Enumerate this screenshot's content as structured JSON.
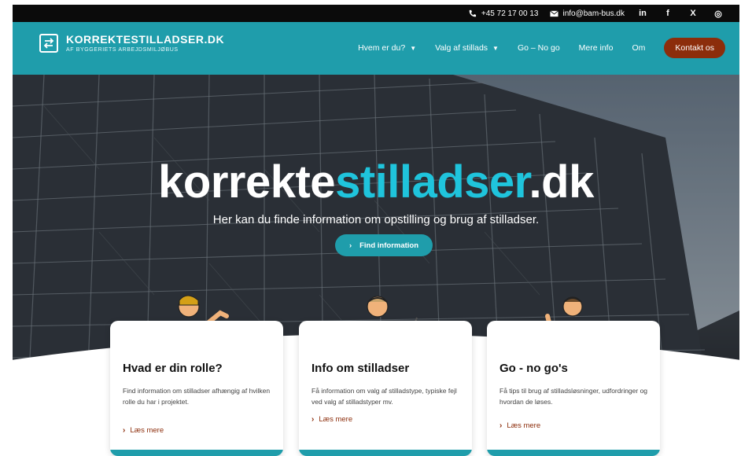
{
  "topbar": {
    "phone": "+45 72 17 00 13",
    "email": "info@bam-bus.dk",
    "social": [
      "in",
      "f",
      "X",
      "◎"
    ]
  },
  "header": {
    "logo_title": "KORREKTESTILLADSER.DK",
    "logo_subtitle": "AF BYGGERIETS ARBEJDSMILJØBUS",
    "nav": {
      "who": "Hvem er du?",
      "choice": "Valg af stillads",
      "gonogo": "Go – No go",
      "more": "Mere info",
      "about": "Om",
      "contact": "Kontakt os"
    }
  },
  "hero": {
    "title_part1": "korrekte",
    "title_part2": "stilladser",
    "title_part3": ".dk",
    "subtitle": "Her kan du finde information om opstilling og brug af stilladser.",
    "button": "Find information"
  },
  "cards": [
    {
      "title": "Hvad er din rolle?",
      "text": "Find information om stilladser afhængig af hvilken rolle du har i projektet.",
      "link": "Læs mere"
    },
    {
      "title": "Info om stilladser",
      "text": "Få information om valg af stilladstype, typiske fejl ved valg af stilladstyper mv.",
      "link": "Læs mere"
    },
    {
      "title": "Go - no go's",
      "text": "Få tips til brug af stilladsløsninger, udfordringer og hvordan de løses.",
      "link": "Læs mere"
    }
  ],
  "colors": {
    "teal": "#1f9dab",
    "accent_cyan": "#1fc4dc",
    "brown": "#8c2d0b",
    "black": "#0b0b0b"
  }
}
